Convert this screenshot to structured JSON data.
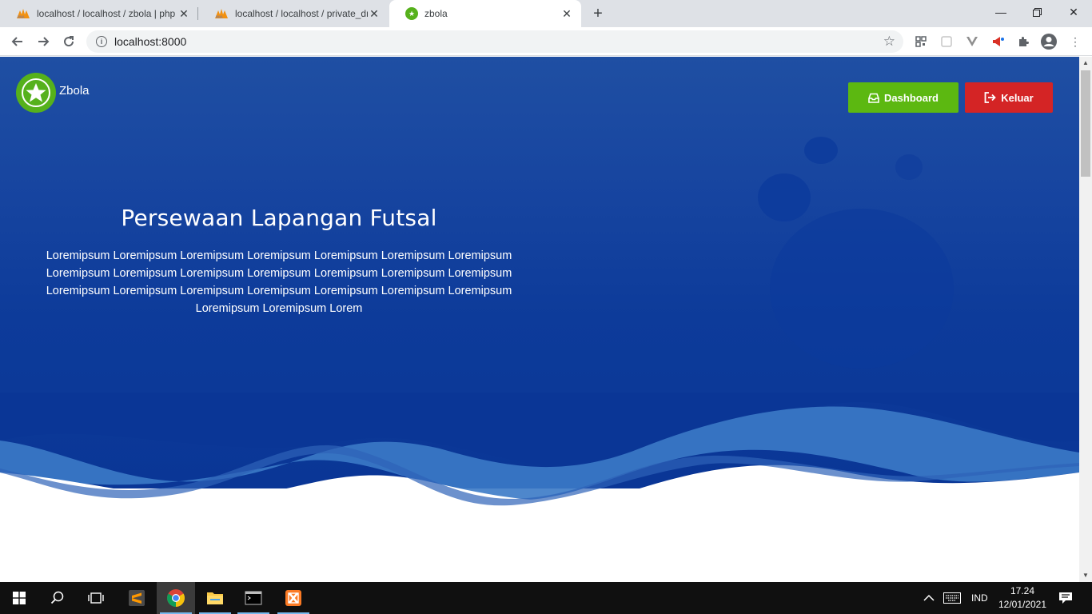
{
  "browser": {
    "tabs": [
      {
        "title": "localhost / localhost / zbola | php",
        "active": false
      },
      {
        "title": "localhost / localhost / private_dri",
        "active": false
      },
      {
        "title": "zbola",
        "active": true
      }
    ],
    "url": "localhost:8000"
  },
  "site": {
    "brand": "Zbola",
    "nav": {
      "dashboard_label": "Dashboard",
      "logout_label": "Keluar"
    },
    "hero": {
      "title": "Persewaan Lapangan Futsal",
      "text": "Loremipsum Loremipsum Loremipsum Loremipsum Loremipsum Loremipsum Loremipsum Loremipsum Loremipsum Loremipsum Loremipsum Loremipsum Loremipsum Loremipsum Loremipsum Loremipsum Loremipsum Loremipsum Loremipsum Loremipsum Loremipsum Loremipsum Loremipsum Lorem"
    },
    "colors": {
      "hero_bg": "#0d3b9a",
      "dashboard_btn": "#5cb811",
      "logout_btn": "#d42425",
      "logo": "#56b11c"
    }
  },
  "taskbar": {
    "language": "IND",
    "time": "17.24",
    "date": "12/01/2021"
  }
}
